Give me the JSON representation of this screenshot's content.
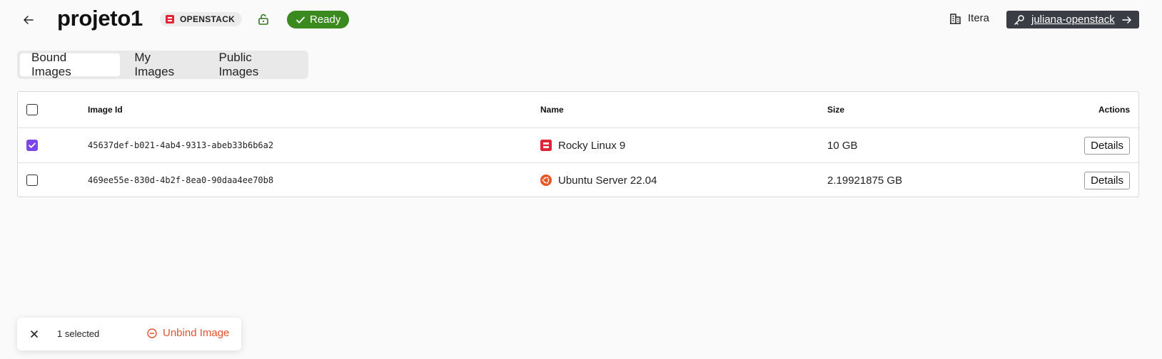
{
  "header": {
    "title": "projeto1",
    "provider_label": "OPENSTACK",
    "status_label": "Ready",
    "organization": "Itera",
    "credential": "juliana-openstack"
  },
  "tabs": [
    {
      "label": "Bound Images",
      "active": true
    },
    {
      "label": "My Images",
      "active": false
    },
    {
      "label": "Public Images",
      "active": false
    }
  ],
  "table": {
    "columns": {
      "image_id": "Image Id",
      "name": "Name",
      "size": "Size",
      "actions": "Actions"
    },
    "rows": [
      {
        "checked": true,
        "image_id": "45637def-b021-4ab4-9313-abeb33b6b6a2",
        "name": "Rocky Linux 9",
        "icon": "openstack-icon",
        "size": "10 GB",
        "action": "Details"
      },
      {
        "checked": false,
        "image_id": "469ee55e-830d-4b2f-8ea0-90daa4ee70b8",
        "name": "Ubuntu Server 22.04",
        "icon": "ubuntu-icon",
        "size": "2.19921875 GB",
        "action": "Details"
      }
    ]
  },
  "selection_bar": {
    "count_label": "1 selected",
    "action_label": "Unbind Image"
  },
  "colors": {
    "accent": "#7b47e8",
    "status_ready": "#3a8a1f",
    "danger": "#e4502f",
    "credential_bg": "#3a3d44",
    "openstack_red": "#e0243a",
    "ubuntu_orange": "#e95420"
  }
}
